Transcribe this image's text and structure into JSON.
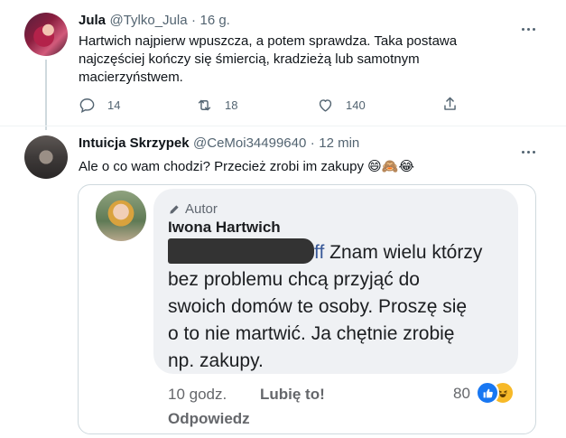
{
  "tweet1": {
    "name": "Jula",
    "handle": "@Tylko_Jula",
    "dot": "·",
    "time": "16 g.",
    "text_line1": "Hartwich najpierw wpuszcza, a potem sprawdza. Taka postawa",
    "text_line2": "najczęściej kończy się śmiercią, kradzieżą lub samotnym",
    "text_line3": "macierzyństwem.",
    "replies": "14",
    "retweets": "18",
    "likes": "140"
  },
  "tweet2": {
    "name": "Intuicja Skrzypek",
    "handle": "@CeMoi34499640",
    "dot": "·",
    "time": "12 min",
    "text": "Ale o co wam chodzi? Przecież zrobi im zakupy",
    "emojis": [
      "😄",
      "🙈",
      "😂"
    ]
  },
  "embed": {
    "author_tag": "Autor",
    "author_name": "Iwona Hartwich",
    "redacted_tail": "ff",
    "body_line1": " Znam wielu którzy",
    "body_line2": "bez problemu  chcą przyjąć do",
    "body_line3": "swoich domów te osoby. Proszę się",
    "body_line4": "o to nie martwić. Ja chętnie zrobię",
    "body_line5": "np. zakupy.",
    "time": "10 godz.",
    "like_label": "Lubię to!",
    "reply_label": "Odpowiedz",
    "reaction_count": "80",
    "reactions": [
      "like-icon",
      "haha-icon"
    ]
  },
  "colors": {
    "text": "#0f1419",
    "muted": "#536471",
    "fb_bubble": "#eff1f4",
    "fb_like": "#1877f2",
    "fb_haha": "#f7b928"
  }
}
